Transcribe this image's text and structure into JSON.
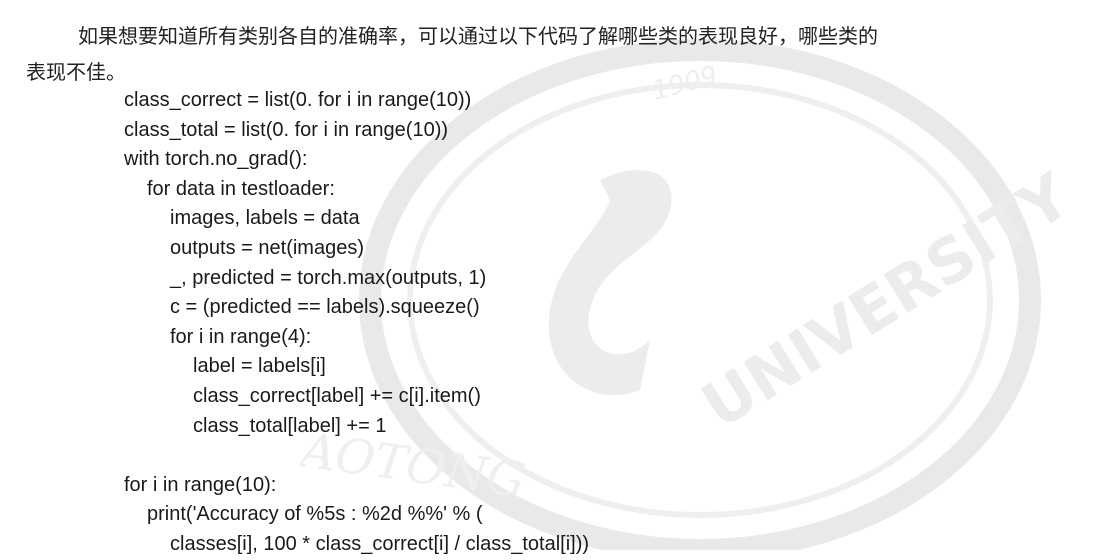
{
  "intro": {
    "line1": "如果想要知道所有类别各自的准确率，可以通过以下代码了解哪些类的表现良好，哪些类的",
    "line2": "表现不佳。"
  },
  "watermark": {
    "text_university": "UNIVERSITY",
    "text_jiaotong": "JIAOTONG",
    "text_year": "1909"
  },
  "code": [
    {
      "text": "class_correct = list(0. for i in range(10))",
      "indent": 0
    },
    {
      "text": "class_total = list(0. for i in range(10))",
      "indent": 0
    },
    {
      "text": "with torch.no_grad():",
      "indent": 0
    },
    {
      "text": "for data in testloader:",
      "indent": 1
    },
    {
      "text": "images, labels = data",
      "indent": 2
    },
    {
      "text": "outputs = net(images)",
      "indent": 2
    },
    {
      "text": "_, predicted = torch.max(outputs, 1)",
      "indent": 2
    },
    {
      "text": "c = (predicted == labels).squeeze()",
      "indent": 2
    },
    {
      "text": "for i in range(4):",
      "indent": 2
    },
    {
      "text": "label = labels[i]",
      "indent": 3
    },
    {
      "text": "class_correct[label] += c[i].item()",
      "indent": 3
    },
    {
      "text": "class_total[label] += 1",
      "indent": 3
    },
    {
      "text": "",
      "indent": 0
    },
    {
      "text": "for i in range(10):",
      "indent": 0
    },
    {
      "text": "print('Accuracy of %5s : %2d %%' % (",
      "indent": 1
    },
    {
      "text": "classes[i], 100 * class_correct[i] / class_total[i]))",
      "indent": 2
    }
  ]
}
